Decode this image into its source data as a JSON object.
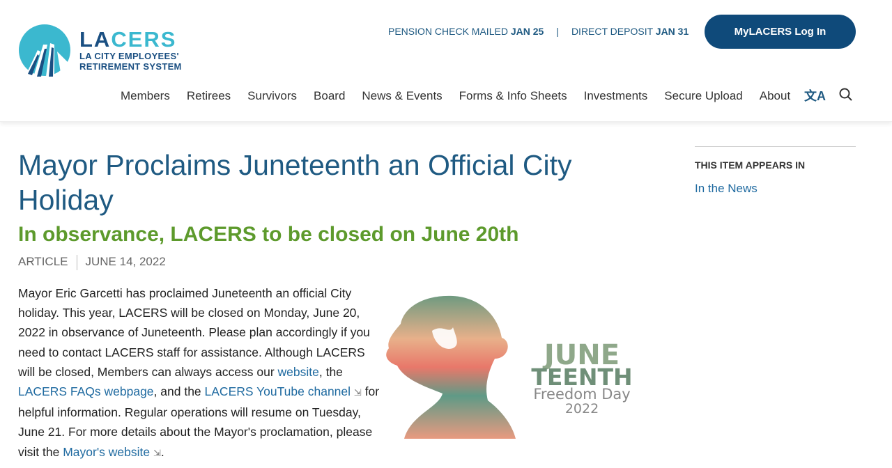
{
  "header": {
    "logo": {
      "name": "LACERS",
      "name_a": "LA",
      "name_b": "CERS",
      "line1": "LA CITY EMPLOYEES'",
      "line2": "RETIREMENT SYSTEM"
    },
    "notice": {
      "pension_label": "PENSION CHECK MAILED",
      "pension_date": "JAN 25",
      "separator": "|",
      "deposit_label": "DIRECT DEPOSIT",
      "deposit_date": "JAN 31"
    },
    "login_label": "MyLACERS Log In",
    "nav": [
      "Members",
      "Retirees",
      "Survivors",
      "Board",
      "News & Events",
      "Forms & Info Sheets",
      "Investments",
      "Secure Upload",
      "About"
    ],
    "icons": {
      "translate": "translate-icon",
      "search": "search-icon"
    }
  },
  "article": {
    "title": "Mayor Proclaims Juneteenth an Official City Holiday",
    "subtitle": "In observance, LACERS to be closed on June 20th",
    "type": "ARTICLE",
    "date": "JUNE 14, 2022",
    "body": {
      "t1": "Mayor Eric Garcetti has proclaimed Juneteenth an official City holiday. This year, LACERS will be closed on Monday, June 20, 2022 in observance of Juneteenth. Please plan accordingly if you need to contact LACERS staff for assistance. Although LACERS will be closed, Members can always access our ",
      "link1": "website",
      "t2": ", the ",
      "link2": "LACERS FAQs webpage",
      "t3": ", and the ",
      "link3": "LACERS YouTube channel",
      "t4": " for helpful information. Regular operations will resume on Tuesday, June 21. For more details about the Mayor's proclamation, please visit the ",
      "link4": "Mayor's website",
      "t5": "."
    },
    "image": {
      "line1": "JUNE",
      "line2": "TEENTH",
      "line3": "Freedom Day",
      "line4": "2022"
    }
  },
  "sidebar": {
    "heading": "THIS ITEM APPEARS IN",
    "link": "In the News"
  },
  "colors": {
    "primary": "#1f5a82",
    "accent": "#5d9a2c",
    "button": "#0f4a7a",
    "logo_light": "#3bb8cf"
  }
}
